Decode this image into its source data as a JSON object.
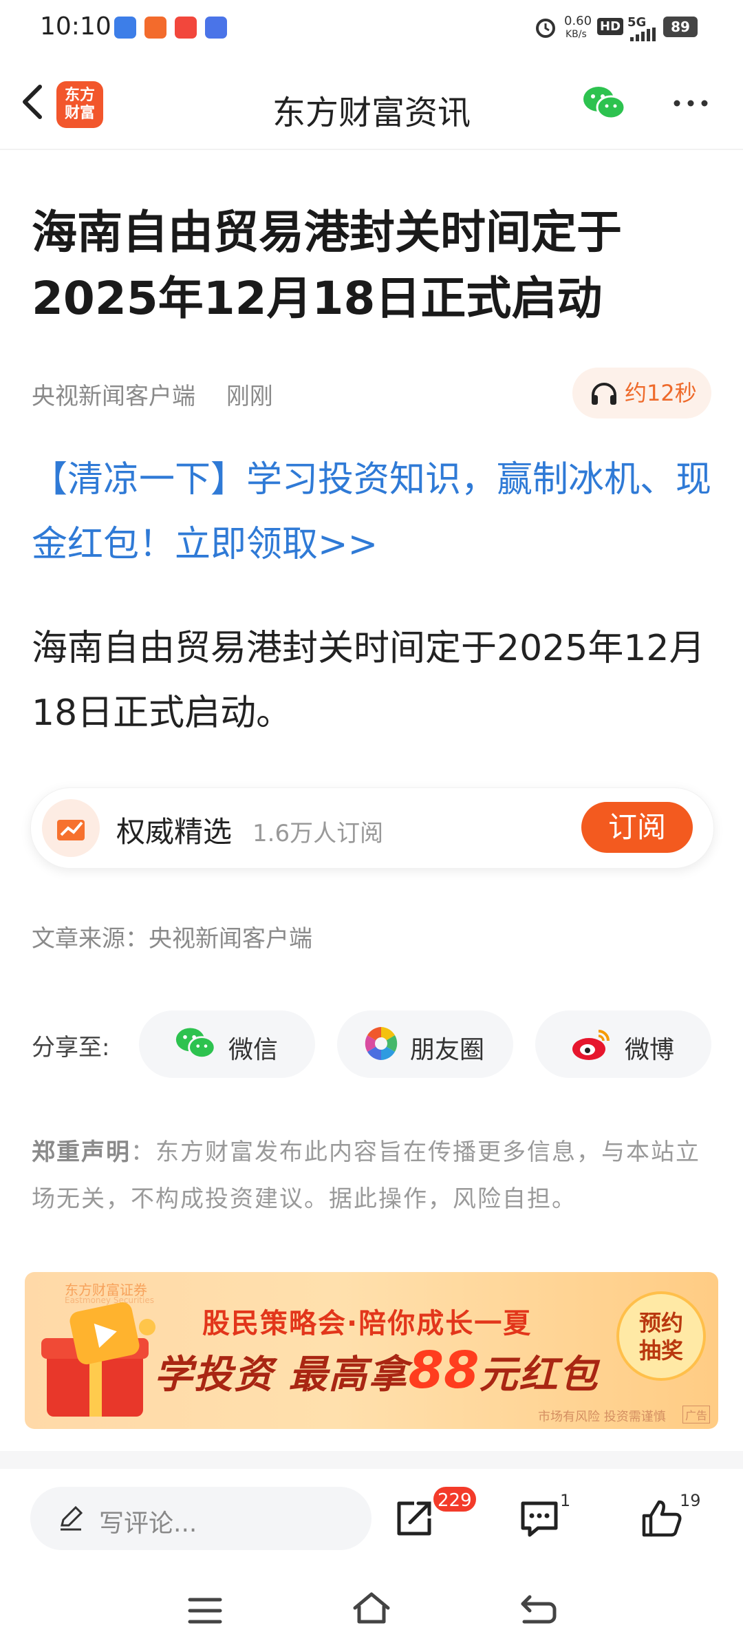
{
  "status_bar": {
    "time": "10:10",
    "net_speed_value": "0.60",
    "net_speed_unit": "KB/s",
    "hd": "HD",
    "network": "5G",
    "battery": "89"
  },
  "nav": {
    "logo_line1": "东方",
    "logo_line2": "财富",
    "title": "东方财富资讯"
  },
  "article": {
    "headline": "海南自由贸易港封关时间定于2025年12月18日正式启动",
    "source_name": "央视新闻客户端",
    "time": "刚刚",
    "listen_label": "约12秒",
    "promo_link": "【清凉一下】学习投资知识，赢制冰机、现金红包！立即领取>>",
    "body": "海南自由贸易港封关时间定于2025年12月18日正式启动。",
    "subscription": {
      "name": "权威精选",
      "count": "1.6万人订阅",
      "button": "订阅"
    },
    "source_line": "文章来源：央视新闻客户端",
    "share": {
      "label": "分享至:",
      "wechat": "微信",
      "moments": "朋友圈",
      "weibo": "微博"
    },
    "disclaimer_title": "郑重声明",
    "disclaimer_text": "：东方财富发布此内容旨在传播更多信息，与本站立场无关，不构成投资建议。据此操作，风险自担。"
  },
  "banner": {
    "brand": "东方财富证券",
    "brand_en": "Eastmoney Securities",
    "line1": "股民策略会·陪你成长一夏",
    "line2_pre": "学投资 最高拿",
    "line2_num": "88",
    "line2_post": "元红包",
    "badge_line1": "预约",
    "badge_line2": "抽奖",
    "fine_print": "市场有风险 投资需谨慎",
    "ad_tag": "广告"
  },
  "bottom_bar": {
    "comment_placeholder": "写评论...",
    "share_count": "229",
    "comment_count": "1",
    "like_count": "19"
  },
  "colors": {
    "accent": "#f35a1f",
    "link": "#2f7ad6",
    "badge": "#f33b2a"
  }
}
